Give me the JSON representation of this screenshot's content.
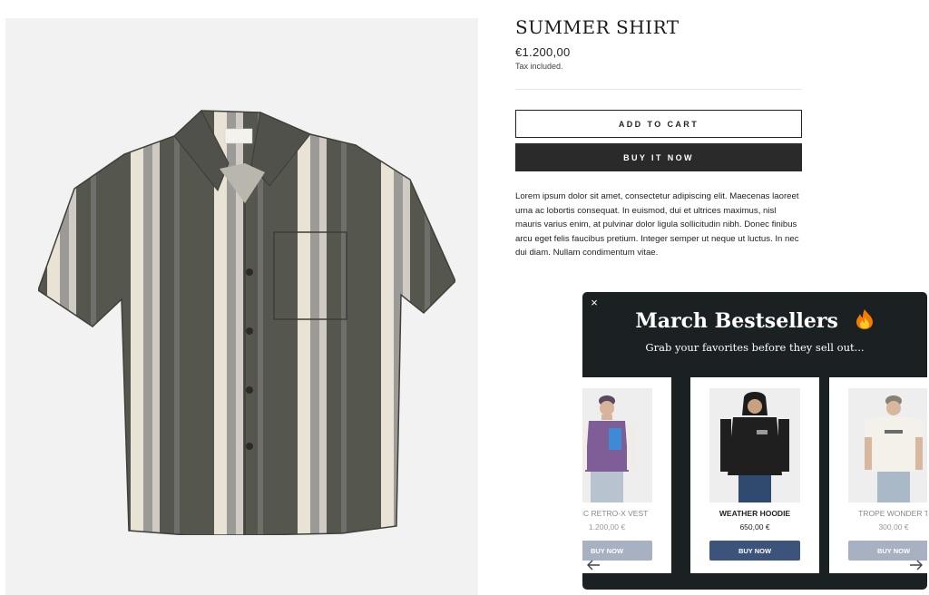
{
  "product": {
    "title": "SUMMER SHIRT",
    "price": "€1.200,00",
    "tax_note": "Tax included.",
    "add_to_cart_label": "ADD TO CART",
    "buy_now_label": "BUY IT NOW",
    "description": "Lorem ipsum dolor sit amet, consectetur adipiscing elit. Maecenas laoreet urna ac lobortis consequat. In euismod, dui et ultrices maximus, nisl mauris varius enim, at pulvinar dolor ligula sollicitudin nibh. Donec finibus arcu eget felis faucibus pretium. Integer semper ut neque ut luctus. In nec dui diam. Nullam condimentum vitae.",
    "image_icon": "striped-shirt-image"
  },
  "popup": {
    "close_label": "×",
    "title": "March Bestsellers",
    "title_icon": "fire-icon",
    "subtitle": "Grab your favorites before they sell out...",
    "products": [
      {
        "name": "ASSIC RETRO-X VEST",
        "price": "1.200,00 €",
        "button": "BUY NOW",
        "image_icon": "vest-model-image"
      },
      {
        "name": "WEATHER HOODIE",
        "price": "650,00 €",
        "button": "BUY NOW",
        "image_icon": "hoodie-model-image"
      },
      {
        "name": "TROPE WONDER T",
        "price": "300,00 €",
        "button": "BUY NOW",
        "image_icon": "tee-model-image"
      }
    ],
    "colors": {
      "background": "#1b2022",
      "button_active": "#3c5479",
      "button_faded": "#a7b1c2"
    }
  }
}
